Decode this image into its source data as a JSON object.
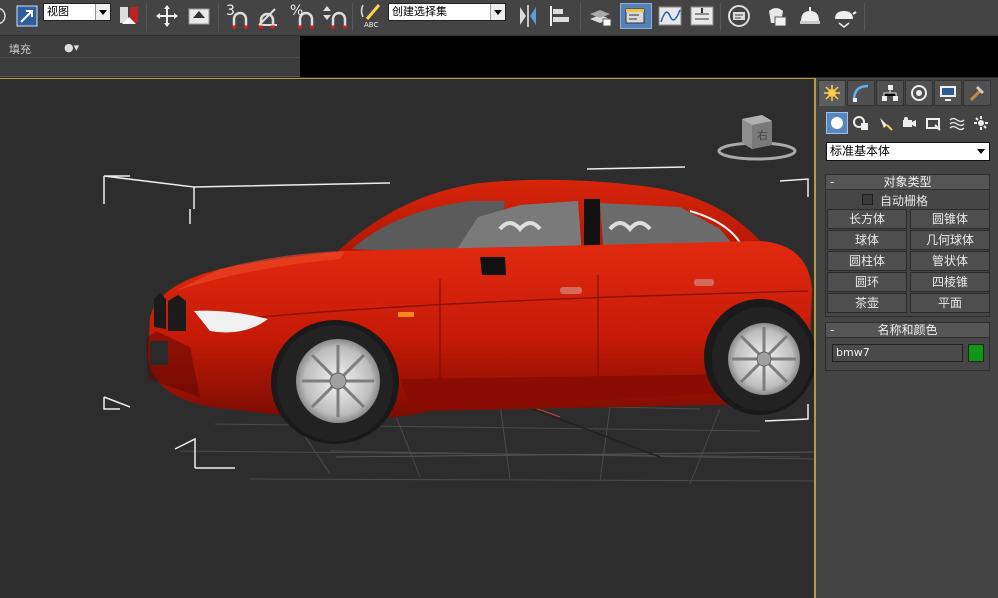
{
  "toolbar": {
    "reference_coord_value": "视图",
    "named_selection_value": "创建选择集",
    "snap_label": "3",
    "percent_snap_label": "%",
    "active_color": "#5580b8"
  },
  "ribbon": {
    "fill_label": "填充"
  },
  "viewport": {
    "gizmo_label": "右",
    "background_color": "#2d2d2d",
    "car_color": "#c41a06"
  },
  "command_panel": {
    "category_dropdown": "标准基本体",
    "object_type": {
      "title": "对象类型",
      "autogrid_label": "自动栅格",
      "buttons": [
        "长方体",
        "圆锥体",
        "球体",
        "几何球体",
        "圆柱体",
        "管状体",
        "圆环",
        "四棱锥",
        "茶壶",
        "平面"
      ]
    },
    "name_color": {
      "title": "名称和颜色",
      "object_name": "bmw7",
      "object_color": "#0c9a14"
    }
  }
}
